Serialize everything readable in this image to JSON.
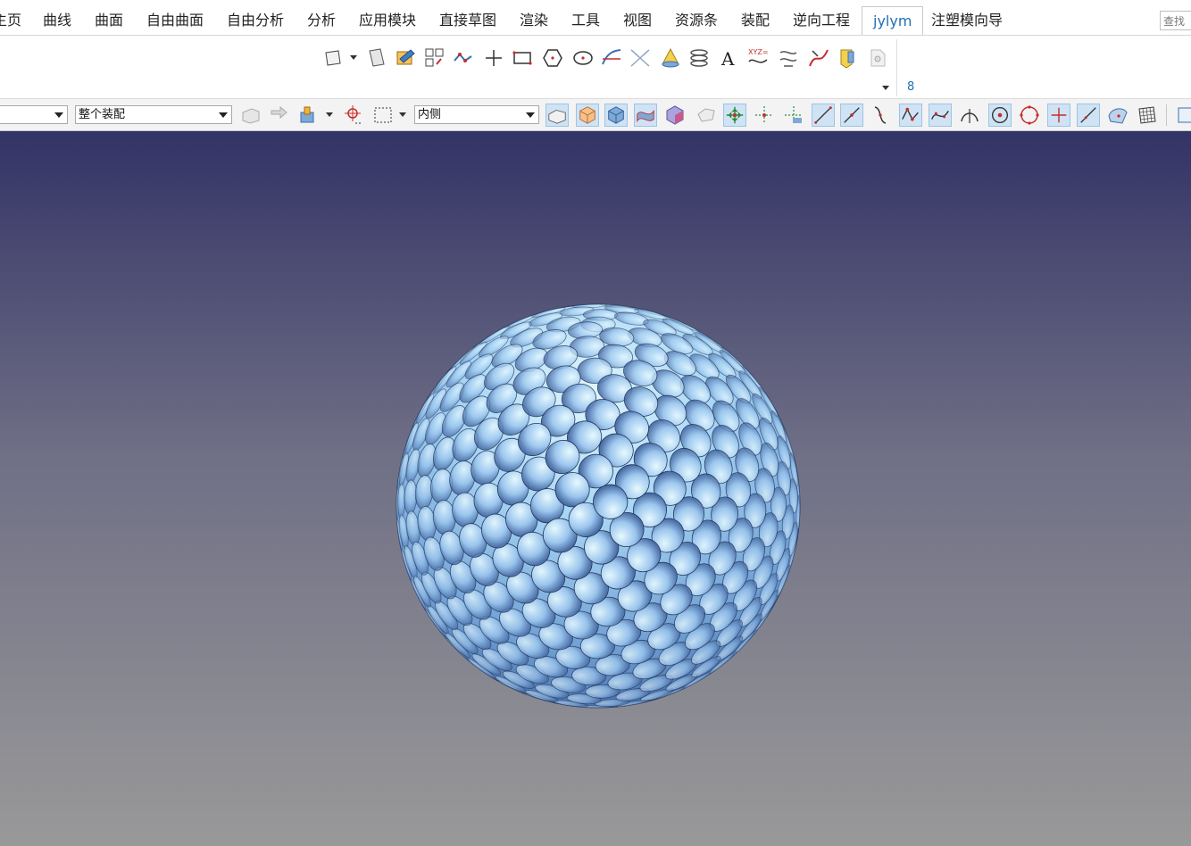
{
  "tabs": [
    {
      "label": "主页",
      "name": "tab-home"
    },
    {
      "label": "曲线",
      "name": "tab-curve"
    },
    {
      "label": "曲面",
      "name": "tab-surface"
    },
    {
      "label": "自由曲面",
      "name": "tab-freeform"
    },
    {
      "label": "自由分析",
      "name": "tab-free-analysis"
    },
    {
      "label": "分析",
      "name": "tab-analysis"
    },
    {
      "label": "应用模块",
      "name": "tab-applications"
    },
    {
      "label": "直接草图",
      "name": "tab-direct-sketch"
    },
    {
      "label": "渲染",
      "name": "tab-render"
    },
    {
      "label": "工具",
      "name": "tab-tools"
    },
    {
      "label": "视图",
      "name": "tab-view"
    },
    {
      "label": "资源条",
      "name": "tab-resource-bar"
    },
    {
      "label": "装配",
      "name": "tab-assembly"
    },
    {
      "label": "逆向工程",
      "name": "tab-reverse-engineering"
    },
    {
      "label": "jylym",
      "name": "tab-jylym"
    },
    {
      "label": "注塑模向导",
      "name": "tab-mold-wizard"
    }
  ],
  "active_tab": "jylym",
  "search_placeholder": "查找命令",
  "ribbon": {
    "group_label": "8",
    "icons": [
      "datum-plane-icon",
      "plane-icon",
      "sketch-icon",
      "pattern-icon",
      "polyline-icon",
      "point-icon",
      "rectangle-icon",
      "polygon-icon",
      "ellipse-icon",
      "offset-curve-icon",
      "intersection-curve-icon",
      "cone-icon",
      "helix-icon",
      "text-icon",
      "law-curve-icon",
      "spline-icon",
      "bridge-curve-icon",
      "extract-icon",
      "more-icon"
    ]
  },
  "selection_bar": {
    "filter_value": "",
    "scope_value": "整个装配",
    "selection_mode_value": "内侧"
  },
  "accent_color": "#1e6fb5",
  "viewport_model": "golf-ball"
}
